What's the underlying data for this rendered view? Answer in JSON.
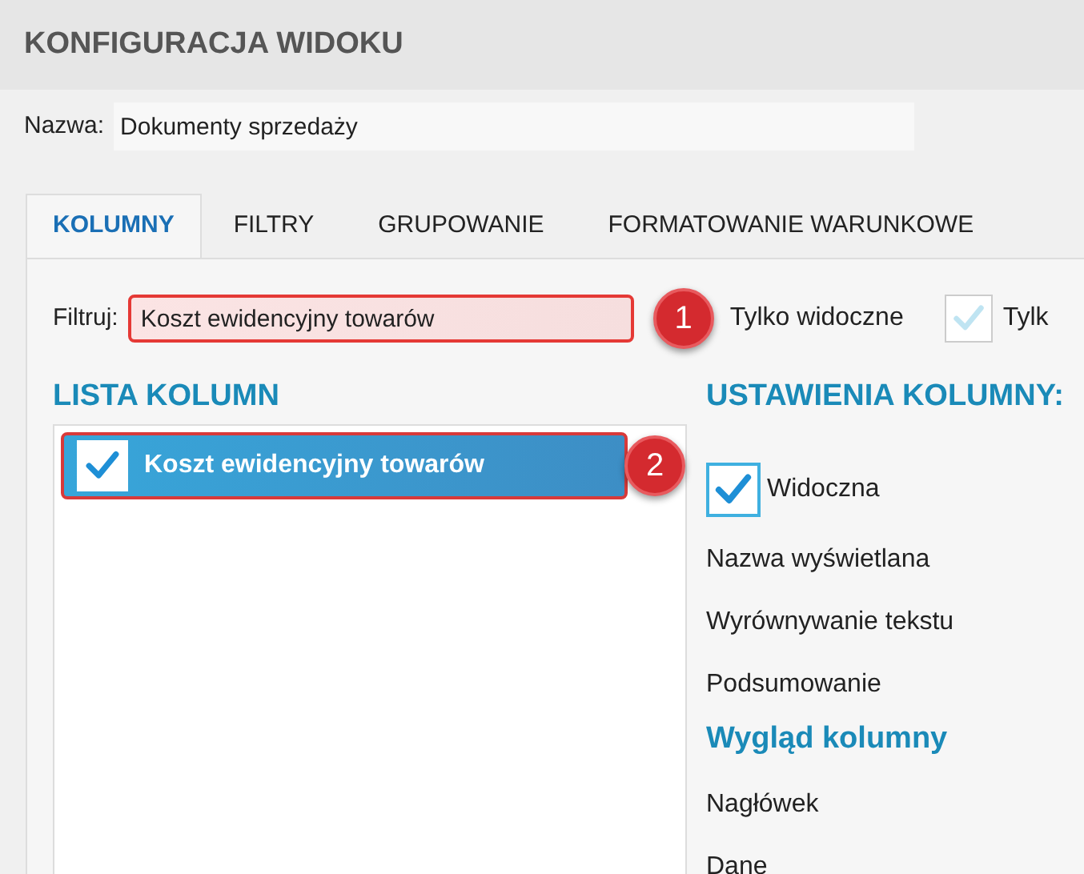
{
  "window": {
    "title": "KONFIGURACJA WIDOKU"
  },
  "name_field": {
    "label": "Nazwa:",
    "value": "Dokumenty sprzedaży"
  },
  "tabs": [
    {
      "label": "KOLUMNY",
      "selected": true
    },
    {
      "label": "FILTRY",
      "selected": false
    },
    {
      "label": "GRUPOWANIE",
      "selected": false
    },
    {
      "label": "FORMATOWANIE WARUNKOWE",
      "selected": false
    }
  ],
  "filter": {
    "label": "Filtruj:",
    "value": "Koszt ewidencyjny towarów",
    "options": [
      {
        "label": "Tylko widoczne",
        "kind": "label"
      },
      {
        "label": "Tylk",
        "kind": "checkbox",
        "checked": true
      }
    ]
  },
  "column_list": {
    "title": "LISTA KOLUMN",
    "items": [
      {
        "label": "Koszt ewidencyjny towarów",
        "checked": true,
        "selected": true
      }
    ]
  },
  "settings": {
    "title": "USTAWIENIA KOLUMNY:",
    "visible": {
      "label": "Widoczna",
      "checked": true
    },
    "fields": [
      "Nazwa wyświetlana",
      "Wyrównywanie tekstu",
      "Podsumowanie"
    ],
    "section": "Wygląd kolumny",
    "section_fields": [
      "Nagłówek",
      "Dane"
    ]
  },
  "callouts": [
    "1",
    "2"
  ]
}
